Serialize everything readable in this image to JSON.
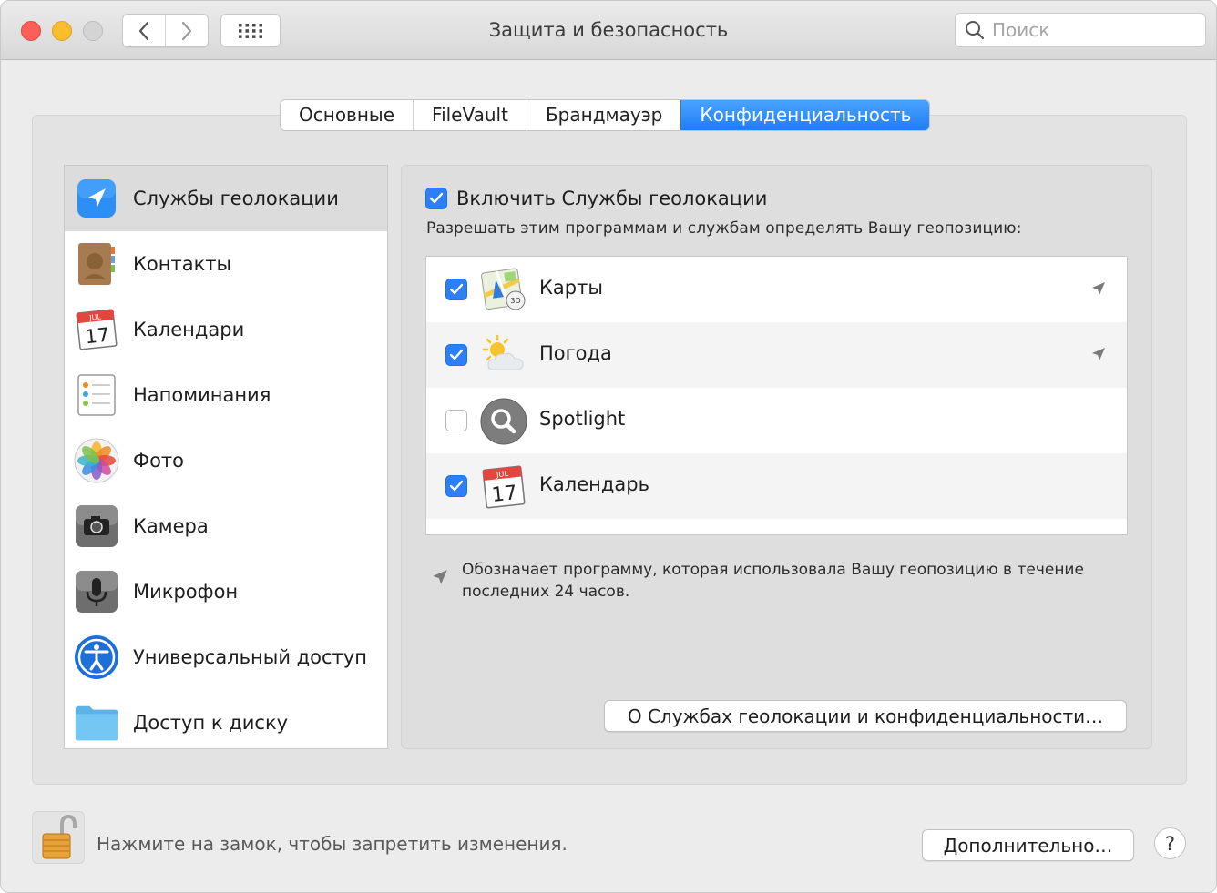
{
  "window": {
    "title": "Защита и безопасность",
    "search_placeholder": "Поиск",
    "traffic_lights": [
      "close",
      "minimize",
      "zoom"
    ],
    "nav_icons": [
      "chevron-left-icon",
      "chevron-right-icon",
      "grid-icon"
    ]
  },
  "tabs": [
    {
      "label": "Основные",
      "active": false
    },
    {
      "label": "FileVault",
      "active": false
    },
    {
      "label": "Брандмауэр",
      "active": false
    },
    {
      "label": "Конфиденциальность",
      "active": true
    }
  ],
  "sidebar": {
    "items": [
      {
        "label": "Службы геолокации",
        "icon": "location-icon",
        "selected": true
      },
      {
        "label": "Контакты",
        "icon": "contacts-icon",
        "selected": false
      },
      {
        "label": "Календари",
        "icon": "calendar-icon",
        "selected": false
      },
      {
        "label": "Напоминания",
        "icon": "reminders-icon",
        "selected": false
      },
      {
        "label": "Фото",
        "icon": "photos-icon",
        "selected": false
      },
      {
        "label": "Камера",
        "icon": "camera-icon",
        "selected": false
      },
      {
        "label": "Микрофон",
        "icon": "microphone-icon",
        "selected": false
      },
      {
        "label": "Универсальный доступ",
        "icon": "accessibility-icon",
        "selected": false
      },
      {
        "label": "Доступ к диску",
        "icon": "folder-icon",
        "selected": false
      }
    ]
  },
  "location": {
    "enable_label": "Включить Службы геолокации",
    "enabled": true,
    "allow_text": "Разрешать этим программам и службам определять Вашу геопозицию:",
    "apps": [
      {
        "name": "Карты",
        "icon": "maps-icon",
        "checked": true,
        "recent": true
      },
      {
        "name": "Погода",
        "icon": "weather-icon",
        "checked": true,
        "recent": true
      },
      {
        "name": "Spotlight",
        "icon": "spotlight-icon",
        "checked": false,
        "recent": false
      },
      {
        "name": "Календарь",
        "icon": "calendar-icon",
        "checked": true,
        "recent": false
      }
    ],
    "legend_text": "Обозначает программу, которая использовала Вашу геопозицию в течение последних 24 часов.",
    "about_button": "О Службах геолокации и конфиденциальности…"
  },
  "calendar_icon": {
    "month": "JUL",
    "day": "17"
  },
  "footer": {
    "lock_text": "Нажмите на замок, чтобы запретить изменения.",
    "advanced_button": "Дополнительно…",
    "help_label": "?"
  },
  "colors": {
    "accent": "#2d7ff9",
    "tab_active": "#1f7df7"
  }
}
